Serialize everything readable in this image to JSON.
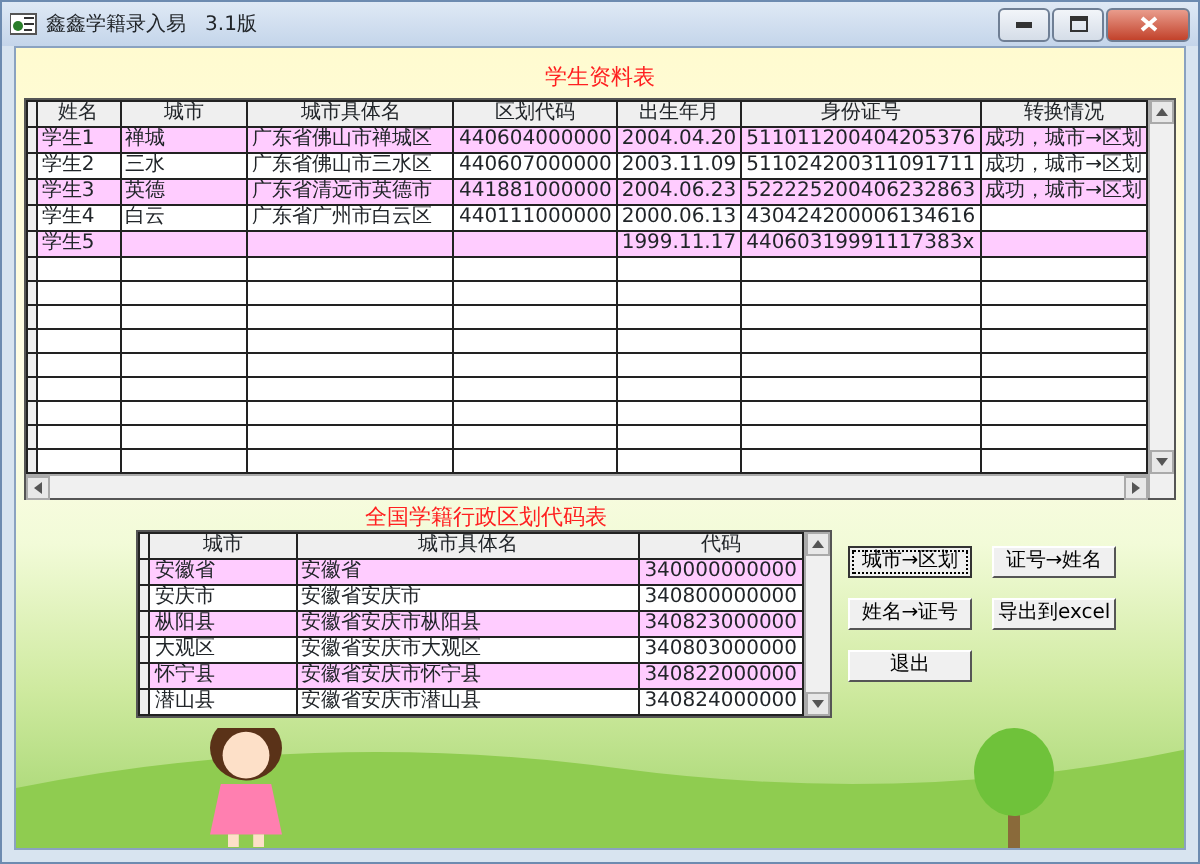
{
  "window": {
    "title": "鑫鑫学籍录入易   3.1版"
  },
  "student_table": {
    "title": "学生资料表",
    "columns": [
      "姓名",
      "城市",
      "城市具体名",
      "区划代码",
      "出生年月",
      "身份证号",
      "转换情况"
    ],
    "rows": [
      [
        "学生1",
        "禅城",
        "广东省佛山市禅城区",
        "440604000000",
        "2004.04.20",
        "511011200404205376",
        "成功，城市→区划"
      ],
      [
        "学生2",
        "三水",
        "广东省佛山市三水区",
        "440607000000",
        "2003.11.09",
        "511024200311091711",
        "成功，城市→区划"
      ],
      [
        "学生3",
        "英德",
        "广东省清远市英德市",
        "441881000000",
        "2004.06.23",
        "522225200406232863",
        "成功，城市→区划"
      ],
      [
        "学生4",
        "白云",
        "广东省广州市白云区",
        "440111000000",
        "2000.06.13",
        "430424200006134616",
        ""
      ],
      [
        "学生5",
        "",
        "",
        "",
        "1999.11.17",
        "44060319991117383x",
        ""
      ]
    ]
  },
  "code_table": {
    "title": "全国学籍行政区划代码表",
    "columns": [
      "城市",
      "城市具体名",
      "代码"
    ],
    "rows": [
      [
        "安徽省",
        "安徽省",
        "340000000000"
      ],
      [
        "安庆市",
        "安徽省安庆市",
        "340800000000"
      ],
      [
        "枞阳县",
        "安徽省安庆市枞阳县",
        "340823000000"
      ],
      [
        "大观区",
        "安徽省安庆市大观区",
        "340803000000"
      ],
      [
        "怀宁县",
        "安徽省安庆市怀宁县",
        "340822000000"
      ],
      [
        "潜山县",
        "安徽省安庆市潜山县",
        "340824000000"
      ]
    ]
  },
  "buttons": [
    {
      "label": "城市→区划",
      "focused": true
    },
    {
      "label": "证号→姓名",
      "focused": false
    },
    {
      "label": "姓名→证号",
      "focused": false
    },
    {
      "label": "导出到excel",
      "focused": false
    },
    {
      "label": "退出",
      "focused": false
    }
  ]
}
